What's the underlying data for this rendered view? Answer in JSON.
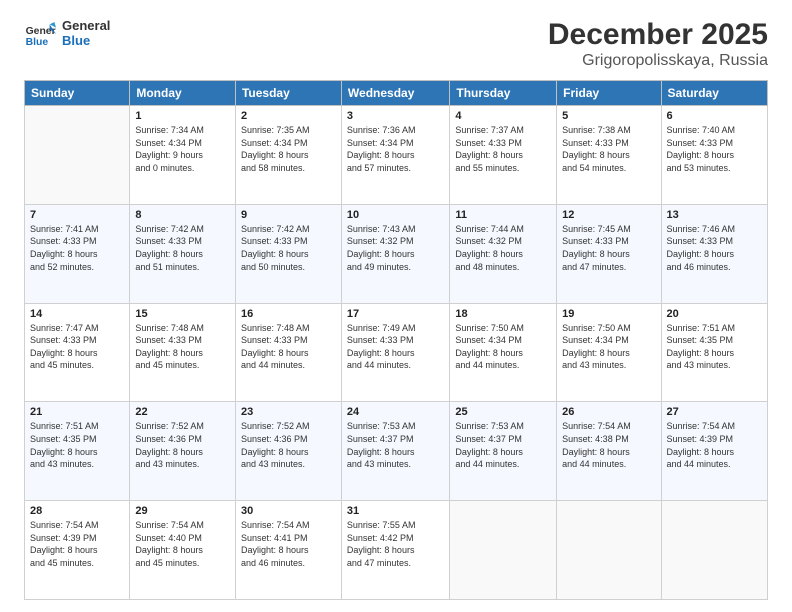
{
  "logo": {
    "line1": "General",
    "line2": "Blue"
  },
  "title": "December 2025",
  "subtitle": "Grigoropolisskaya, Russia",
  "header": {
    "days": [
      "Sunday",
      "Monday",
      "Tuesday",
      "Wednesday",
      "Thursday",
      "Friday",
      "Saturday"
    ]
  },
  "weeks": [
    [
      {
        "day": "",
        "content": ""
      },
      {
        "day": "1",
        "content": "Sunrise: 7:34 AM\nSunset: 4:34 PM\nDaylight: 9 hours\nand 0 minutes."
      },
      {
        "day": "2",
        "content": "Sunrise: 7:35 AM\nSunset: 4:34 PM\nDaylight: 8 hours\nand 58 minutes."
      },
      {
        "day": "3",
        "content": "Sunrise: 7:36 AM\nSunset: 4:34 PM\nDaylight: 8 hours\nand 57 minutes."
      },
      {
        "day": "4",
        "content": "Sunrise: 7:37 AM\nSunset: 4:33 PM\nDaylight: 8 hours\nand 55 minutes."
      },
      {
        "day": "5",
        "content": "Sunrise: 7:38 AM\nSunset: 4:33 PM\nDaylight: 8 hours\nand 54 minutes."
      },
      {
        "day": "6",
        "content": "Sunrise: 7:40 AM\nSunset: 4:33 PM\nDaylight: 8 hours\nand 53 minutes."
      }
    ],
    [
      {
        "day": "7",
        "content": "Sunrise: 7:41 AM\nSunset: 4:33 PM\nDaylight: 8 hours\nand 52 minutes."
      },
      {
        "day": "8",
        "content": "Sunrise: 7:42 AM\nSunset: 4:33 PM\nDaylight: 8 hours\nand 51 minutes."
      },
      {
        "day": "9",
        "content": "Sunrise: 7:42 AM\nSunset: 4:33 PM\nDaylight: 8 hours\nand 50 minutes."
      },
      {
        "day": "10",
        "content": "Sunrise: 7:43 AM\nSunset: 4:32 PM\nDaylight: 8 hours\nand 49 minutes."
      },
      {
        "day": "11",
        "content": "Sunrise: 7:44 AM\nSunset: 4:32 PM\nDaylight: 8 hours\nand 48 minutes."
      },
      {
        "day": "12",
        "content": "Sunrise: 7:45 AM\nSunset: 4:33 PM\nDaylight: 8 hours\nand 47 minutes."
      },
      {
        "day": "13",
        "content": "Sunrise: 7:46 AM\nSunset: 4:33 PM\nDaylight: 8 hours\nand 46 minutes."
      }
    ],
    [
      {
        "day": "14",
        "content": "Sunrise: 7:47 AM\nSunset: 4:33 PM\nDaylight: 8 hours\nand 45 minutes."
      },
      {
        "day": "15",
        "content": "Sunrise: 7:48 AM\nSunset: 4:33 PM\nDaylight: 8 hours\nand 45 minutes."
      },
      {
        "day": "16",
        "content": "Sunrise: 7:48 AM\nSunset: 4:33 PM\nDaylight: 8 hours\nand 44 minutes."
      },
      {
        "day": "17",
        "content": "Sunrise: 7:49 AM\nSunset: 4:33 PM\nDaylight: 8 hours\nand 44 minutes."
      },
      {
        "day": "18",
        "content": "Sunrise: 7:50 AM\nSunset: 4:34 PM\nDaylight: 8 hours\nand 44 minutes."
      },
      {
        "day": "19",
        "content": "Sunrise: 7:50 AM\nSunset: 4:34 PM\nDaylight: 8 hours\nand 43 minutes."
      },
      {
        "day": "20",
        "content": "Sunrise: 7:51 AM\nSunset: 4:35 PM\nDaylight: 8 hours\nand 43 minutes."
      }
    ],
    [
      {
        "day": "21",
        "content": "Sunrise: 7:51 AM\nSunset: 4:35 PM\nDaylight: 8 hours\nand 43 minutes."
      },
      {
        "day": "22",
        "content": "Sunrise: 7:52 AM\nSunset: 4:36 PM\nDaylight: 8 hours\nand 43 minutes."
      },
      {
        "day": "23",
        "content": "Sunrise: 7:52 AM\nSunset: 4:36 PM\nDaylight: 8 hours\nand 43 minutes."
      },
      {
        "day": "24",
        "content": "Sunrise: 7:53 AM\nSunset: 4:37 PM\nDaylight: 8 hours\nand 43 minutes."
      },
      {
        "day": "25",
        "content": "Sunrise: 7:53 AM\nSunset: 4:37 PM\nDaylight: 8 hours\nand 44 minutes."
      },
      {
        "day": "26",
        "content": "Sunrise: 7:54 AM\nSunset: 4:38 PM\nDaylight: 8 hours\nand 44 minutes."
      },
      {
        "day": "27",
        "content": "Sunrise: 7:54 AM\nSunset: 4:39 PM\nDaylight: 8 hours\nand 44 minutes."
      }
    ],
    [
      {
        "day": "28",
        "content": "Sunrise: 7:54 AM\nSunset: 4:39 PM\nDaylight: 8 hours\nand 45 minutes."
      },
      {
        "day": "29",
        "content": "Sunrise: 7:54 AM\nSunset: 4:40 PM\nDaylight: 8 hours\nand 45 minutes."
      },
      {
        "day": "30",
        "content": "Sunrise: 7:54 AM\nSunset: 4:41 PM\nDaylight: 8 hours\nand 46 minutes."
      },
      {
        "day": "31",
        "content": "Sunrise: 7:55 AM\nSunset: 4:42 PM\nDaylight: 8 hours\nand 47 minutes."
      },
      {
        "day": "",
        "content": ""
      },
      {
        "day": "",
        "content": ""
      },
      {
        "day": "",
        "content": ""
      }
    ]
  ]
}
